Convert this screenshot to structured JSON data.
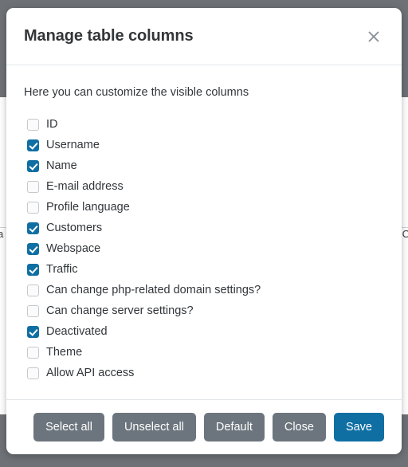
{
  "backdrop": {
    "left_text": "a",
    "right_text": "C"
  },
  "modal": {
    "title": "Manage table columns",
    "close_icon": "close-icon",
    "intro": "Here you can customize the visible columns",
    "columns": [
      {
        "label": "ID",
        "checked": false
      },
      {
        "label": "Username",
        "checked": true
      },
      {
        "label": "Name",
        "checked": true
      },
      {
        "label": "E-mail address",
        "checked": false
      },
      {
        "label": "Profile language",
        "checked": false
      },
      {
        "label": "Customers",
        "checked": true
      },
      {
        "label": "Webspace",
        "checked": true
      },
      {
        "label": "Traffic",
        "checked": true
      },
      {
        "label": "Can change php-related domain settings?",
        "checked": false
      },
      {
        "label": "Can change server settings?",
        "checked": false
      },
      {
        "label": "Deactivated",
        "checked": true
      },
      {
        "label": "Theme",
        "checked": false
      },
      {
        "label": "Allow API access",
        "checked": false
      }
    ],
    "footer": {
      "select_all": "Select all",
      "unselect_all": "Unselect all",
      "default": "Default",
      "close": "Close",
      "save": "Save"
    }
  },
  "colors": {
    "accent": "#0f6fa3",
    "secondary": "#6c757d",
    "backdrop": "#6e7276",
    "text": "#32363a"
  }
}
